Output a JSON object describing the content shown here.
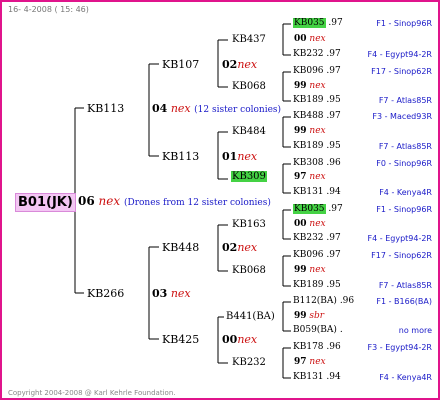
{
  "header": "16- 4-2008 ( 15: 46)",
  "footer": "Copyright 2004-2008 @ Karl Kehrle Foundation.",
  "root": "B01(JK)",
  "gen1": {
    "num": "06",
    "nex": "nex",
    "note": "(Drones from 12 sister colonies)"
  },
  "gen2": [
    {
      "label": "KB113",
      "num": "04",
      "nex": "nex",
      "note": "(12 sister colonies)"
    },
    {
      "label": "KB266",
      "num": "03",
      "nex": "nex"
    }
  ],
  "gen3": [
    {
      "label": "KB107",
      "num": "02",
      "nex": "nex"
    },
    {
      "label": "KB113",
      "num": "01",
      "nex": "nex"
    },
    {
      "label": "KB448",
      "num": "02",
      "nex": "nex"
    },
    {
      "label": "KB425",
      "num": "00",
      "nex": "nex"
    }
  ],
  "gen4": [
    {
      "label": "KB437",
      "num": "00",
      "nex": "nex"
    },
    {
      "label": "KB068",
      "num": "99",
      "nex": "nex"
    },
    {
      "label": "KB484",
      "num": "99",
      "nex": "nex"
    },
    {
      "label": "KB309",
      "num": "97",
      "nex": "nex"
    },
    {
      "label": "KB163",
      "num": "00",
      "nex": "nex"
    },
    {
      "label": "KB068",
      "num": "99",
      "nex": "nex"
    },
    {
      "label": "B441(BA)",
      "num": "99",
      "nex": "sbr"
    },
    {
      "label": "KB232",
      "num": "97",
      "nex": "nex"
    }
  ],
  "gen5": [
    {
      "label": "KB035",
      "pct": ".97",
      "right": "F1 - Sinop96R"
    },
    {
      "label": "KB232",
      "pct": ".97",
      "right": "F4 - Egypt94-2R"
    },
    {
      "label": "KB096",
      "pct": ".97",
      "right": "F17 - Sinop62R"
    },
    {
      "label": "KB189",
      "pct": ".95",
      "right": "F7 - Atlas85R"
    },
    {
      "label": "KB488",
      "pct": ".97",
      "right": "F3 - Maced93R"
    },
    {
      "label": "KB189",
      "pct": ".95",
      "right": "F7 - Atlas85R"
    },
    {
      "label": "KB308",
      "pct": ".96",
      "right": "F0 - Sinop96R"
    },
    {
      "label": "KB131",
      "pct": ".94",
      "right": "F4 - Kenya4R"
    },
    {
      "label": "KB035",
      "pct": ".97",
      "right": "F1 - Sinop96R"
    },
    {
      "label": "KB232",
      "pct": ".97",
      "right": "F4 - Egypt94-2R"
    },
    {
      "label": "KB096",
      "pct": ".97",
      "right": "F17 - Sinop62R"
    },
    {
      "label": "KB189",
      "pct": ".95",
      "right": "F7 - Atlas85R"
    },
    {
      "label": "B112(BA)",
      "pct": ".96",
      "right": "F1 - B166(BA)"
    },
    {
      "label": "B059(BA)",
      "pct": ".",
      "right": "no more"
    },
    {
      "label": "KB178",
      "pct": ".96",
      "right": "F3 - Egypt94-2R"
    },
    {
      "label": "KB131",
      "pct": ".94",
      "right": "F4 - Kenya4R"
    }
  ],
  "colors": {
    "border": "#e0148c",
    "root_bg": "#f3c6f3",
    "highlight": "#44d244",
    "nex": "#cc1111",
    "link": "#1a1ac8"
  }
}
